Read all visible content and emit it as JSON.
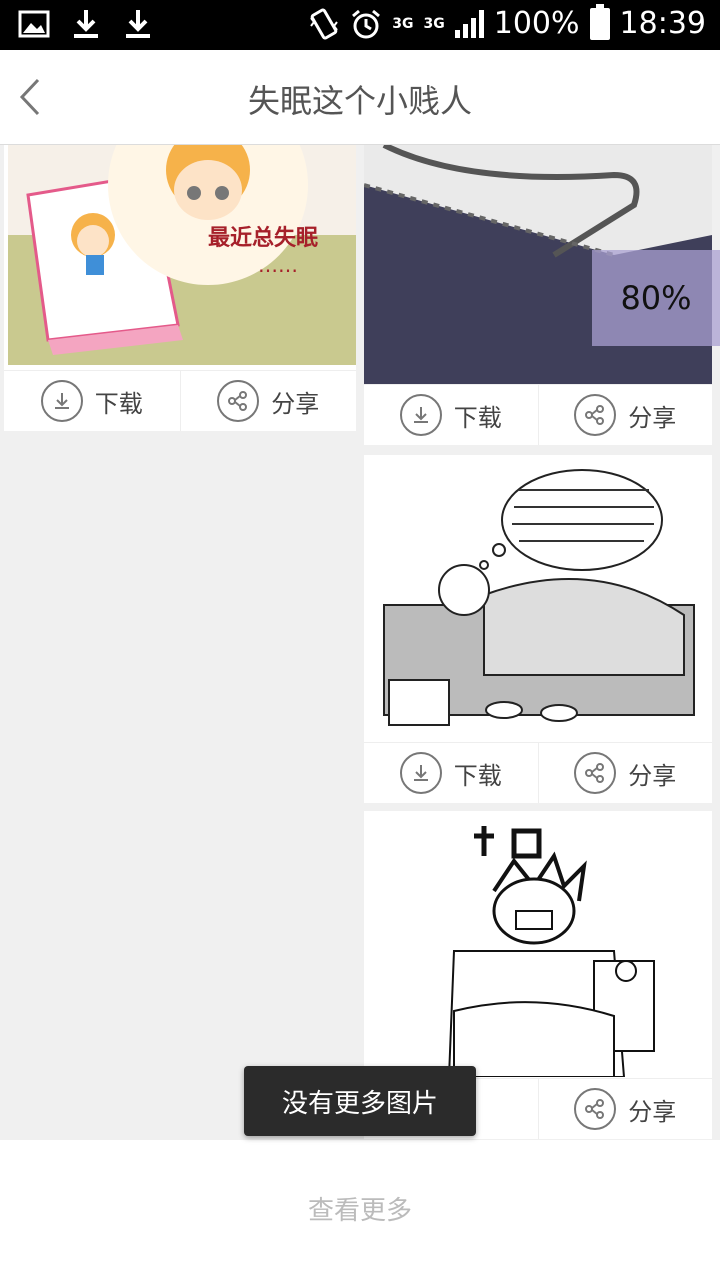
{
  "status_bar": {
    "network_1": "3G",
    "network_2": "3G",
    "battery": "100%",
    "time": "18:39",
    "icons": [
      "image-icon",
      "download-icon",
      "download-icon",
      "vibrate-icon",
      "alarm-icon",
      "signal-icon",
      "battery-icon"
    ]
  },
  "header": {
    "title": "失眠这个小贱人",
    "back_icon": "back-chevron-icon"
  },
  "cards": [
    {
      "image_desc": "cartoon-girl-in-bed",
      "image_text": "最近总失眠",
      "image_dots": "……",
      "download_label": "下载",
      "share_label": "分享"
    },
    {
      "image_desc": "bed-sheet-pattern",
      "download_label": "下载",
      "share_label": "分享"
    },
    {
      "image_desc": "counting-sheep-comic",
      "download_label": "下载",
      "share_label": "分享"
    },
    {
      "image_desc": "insomnia-comic",
      "download_label": "载",
      "share_label": "分享"
    }
  ],
  "progress_overlay": "80%",
  "toast": "没有更多图片",
  "load_more": "查看更多",
  "colors": {
    "status_bar_bg": "#000000",
    "title_text": "#555555",
    "toast_bg": "#2b2b2b",
    "load_more_text": "#bbbbbb"
  }
}
